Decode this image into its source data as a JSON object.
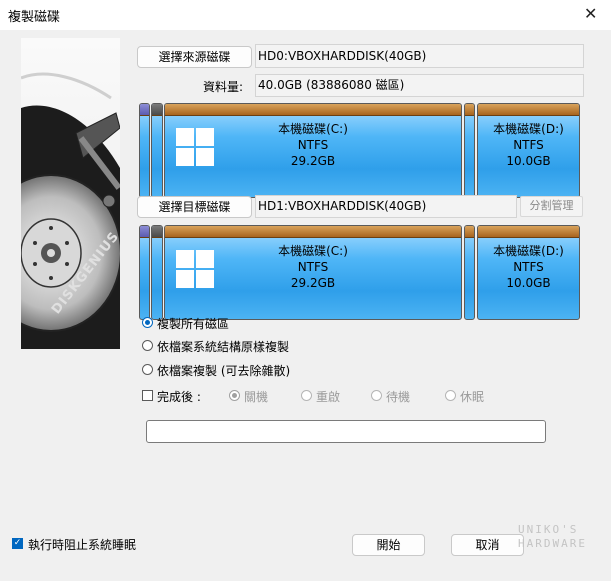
{
  "window": {
    "title": "複製磁碟",
    "close_glyph": "✕"
  },
  "branding": {
    "side_art_text": "DISKGENIUS"
  },
  "source": {
    "button_label": "選擇來源磁碟",
    "disk_name": "HD0:VBOXHARDDISK(40GB)",
    "size_label": "資料量:",
    "size_value": "40.0GB (83886080 磁區)",
    "partitions": [
      {
        "kind": "system-reserved-1"
      },
      {
        "kind": "system-reserved-2"
      },
      {
        "name": "本機磁碟(C:)",
        "fs": "NTFS",
        "size": "29.2GB",
        "windows_logo": true
      },
      {
        "kind": "recovery"
      },
      {
        "name": "本機磁碟(D:)",
        "fs": "NTFS",
        "size": "10.0GB"
      }
    ]
  },
  "target": {
    "button_label": "選擇目標磁碟",
    "disk_name": "HD1:VBOXHARDDISK(40GB)",
    "manage_label": "分割管理",
    "partitions": [
      {
        "kind": "system-reserved-1"
      },
      {
        "kind": "system-reserved-2"
      },
      {
        "name": "本機磁碟(C:)",
        "fs": "NTFS",
        "size": "29.2GB",
        "windows_logo": true
      },
      {
        "kind": "recovery"
      },
      {
        "name": "本機磁碟(D:)",
        "fs": "NTFS",
        "size": "10.0GB"
      }
    ]
  },
  "copy_mode": {
    "options": [
      "複製所有磁區",
      "依檔案系統結構原樣複製",
      "依檔案複製 (可去除雜散)"
    ],
    "selected": "複製所有磁區"
  },
  "after_complete": {
    "label": "完成後 :",
    "checked": false,
    "options": [
      "關機",
      "重啟",
      "待機",
      "休眠"
    ],
    "selected": "關機"
  },
  "progress": {
    "value": 0
  },
  "footer": {
    "prevent_sleep_label": "執行時阻止系統睡眠",
    "prevent_sleep_checked": true,
    "start_label": "開始",
    "cancel_label": "取消"
  },
  "watermark": {
    "line1": "UNIKO'S",
    "line2": "HARDWARE"
  },
  "colors": {
    "accent": "#0067c0",
    "partition_blue": "#2f9fea",
    "partition_cap": "#a8641e"
  }
}
